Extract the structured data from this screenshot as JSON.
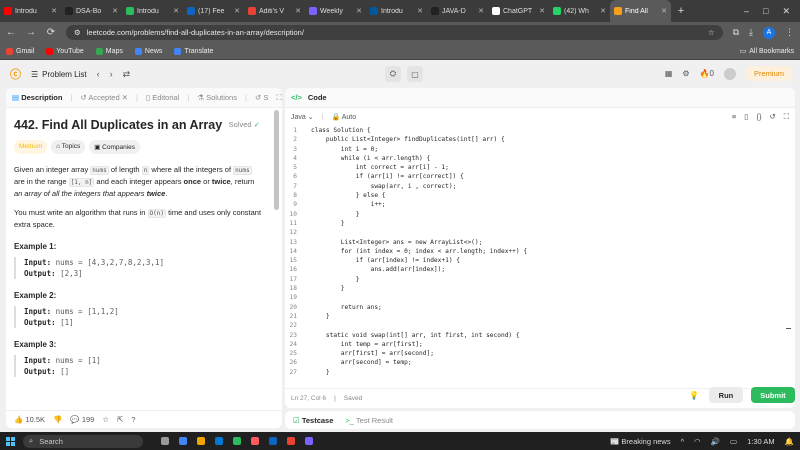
{
  "browser": {
    "tabs": [
      {
        "label": "Introdu",
        "color": "#ff0000"
      },
      {
        "label": "DSA-Bo",
        "color": "#222222"
      },
      {
        "label": "Introdu",
        "color": "#2cbb5d"
      },
      {
        "label": "(17) Fee",
        "color": "#0a66c2"
      },
      {
        "label": "Aditi's V",
        "color": "#ea4335"
      },
      {
        "label": "Weekly",
        "color": "#7b61ff"
      },
      {
        "label": "Introdu",
        "color": "#00599c"
      },
      {
        "label": "JAVA-D",
        "color": "#222222"
      },
      {
        "label": "ChatGPT",
        "color": "#ffffff"
      },
      {
        "label": "(42) Wh",
        "color": "#25d366"
      },
      {
        "label": "Find All",
        "color": "#f89f1b",
        "active": true
      }
    ],
    "new_tab": "+",
    "url": "leetcode.com/problems/find-all-duplicates-in-an-array/description/",
    "profile_initial": "A",
    "bookmarks": [
      {
        "label": "Gmail",
        "color": "#ea4335"
      },
      {
        "label": "YouTube",
        "color": "#ff0000"
      },
      {
        "label": "Maps",
        "color": "#34a853"
      },
      {
        "label": "News",
        "color": "#4285f4"
      },
      {
        "label": "Translate",
        "color": "#4285f4"
      }
    ],
    "all_bookmarks": "All Bookmarks"
  },
  "header": {
    "problem_list": "Problem List",
    "streak": "0",
    "premium": "Premium"
  },
  "left": {
    "tabs": [
      "Description",
      "Accepted",
      "Editorial",
      "Solutions",
      "S"
    ],
    "title": "442. Find All Duplicates in an Array",
    "solved": "Solved",
    "tags": [
      "Medium",
      "Topics",
      "Companies"
    ],
    "desc": {
      "p1_a": "Given an integer array ",
      "p1_code1": "nums",
      "p1_b": " of length ",
      "p1_code2": "n",
      "p1_c": " where all the integers of ",
      "p1_code3": "nums",
      "p1_d": " are in the range ",
      "p1_code4": "[1, n]",
      "p1_e": " and each integer appears ",
      "p1_once": "once",
      "p1_f": " or ",
      "p1_twice": "twice",
      "p1_g": ", return ",
      "p1_italic": "an array of all the integers that appears ",
      "p1_twice2": "twice",
      "p1_end": ".",
      "p2_a": "You must write an algorithm that runs in ",
      "p2_code": "O(n)",
      "p2_b": " time and uses only constant extra space."
    },
    "examples": [
      {
        "title": "Example 1:",
        "input_label": "Input:",
        "input": "nums = [4,3,2,7,8,2,3,1]",
        "output_label": "Output:",
        "output": "[2,3]"
      },
      {
        "title": "Example 2:",
        "input_label": "Input:",
        "input": "nums = [1,1,2]",
        "output_label": "Output:",
        "output": "[1]"
      },
      {
        "title": "Example 3:",
        "input_label": "Input:",
        "input": "nums = [1]",
        "output_label": "Output:",
        "output": "[]"
      }
    ],
    "footer": {
      "likes": "10.5K",
      "comments": "199"
    }
  },
  "right": {
    "tab": "Code",
    "language": "Java",
    "auto": "Auto",
    "code": [
      "class Solution {",
      "    public List<Integer> findDuplicates(int[] arr) {",
      "        int i = 0;",
      "        while (i < arr.length) {",
      "            int correct = arr[i] - 1;",
      "            if (arr[i] != arr[correct]) {",
      "                swap(arr, i , correct);",
      "            } else {",
      "                i++;",
      "            }",
      "        }",
      "",
      "        List<Integer> ans = new ArrayList<>();",
      "        for (int index = 0; index < arr.length; index++) {",
      "            if (arr[index] != index+1) {",
      "                ans.add(arr[index]);",
      "            }",
      "        }",
      "",
      "        return ans;",
      "    }",
      "",
      "    static void swap(int[] arr, int first, int second) {",
      "        int temp = arr[first];",
      "        arr[first] = arr[second];",
      "        arr[second] = temp;",
      "    }"
    ],
    "status": "Ln 27, Col 6",
    "saved": "Saved",
    "run": "Run",
    "submit": "Submit",
    "testcase": "Testcase",
    "test_result": "Test Result"
  },
  "taskbar": {
    "search": "Search",
    "news": "Breaking news",
    "time": "1:30 AM"
  }
}
